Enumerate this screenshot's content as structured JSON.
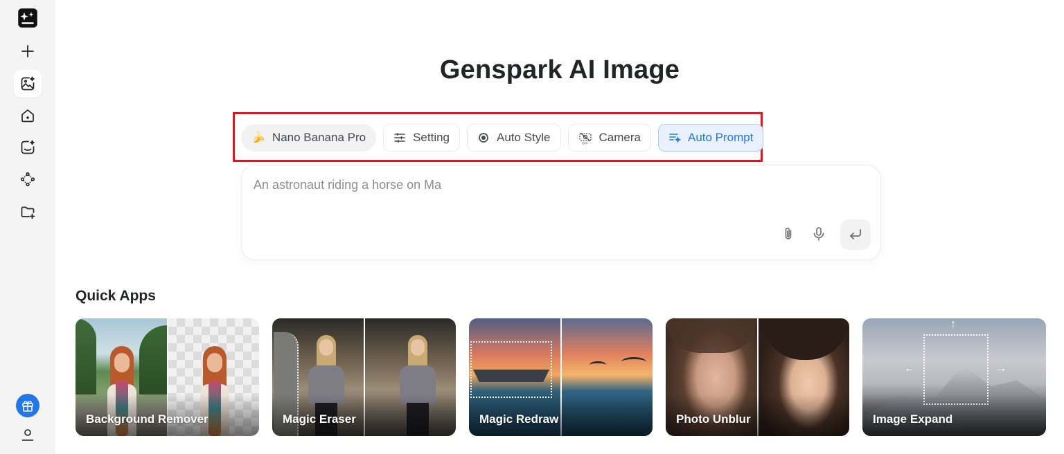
{
  "sidebar": {
    "items": [
      {
        "icon": "genspark-logo-icon"
      },
      {
        "icon": "plus-icon"
      },
      {
        "icon": "ai-image-icon",
        "active": true
      },
      {
        "icon": "home-icon"
      },
      {
        "icon": "image-sparkle-icon"
      },
      {
        "icon": "nodes-icon"
      },
      {
        "icon": "folder-add-icon"
      },
      {
        "icon": "gift-icon"
      },
      {
        "icon": "user-icon"
      }
    ]
  },
  "title": "Genspark AI Image",
  "toolbar": {
    "model_label": "Nano Banana Pro",
    "setting_label": "Setting",
    "style_label": "Auto Style",
    "camera_label": "Camera",
    "prompt_label": "Auto Prompt"
  },
  "prompt": {
    "placeholder": "An astronaut riding a horse on Ma"
  },
  "quick_apps": {
    "title": "Quick Apps",
    "items": [
      {
        "label": "Background Remover"
      },
      {
        "label": "Magic Eraser"
      },
      {
        "label": "Magic Redraw"
      },
      {
        "label": "Photo Unblur"
      },
      {
        "label": "Image Expand"
      }
    ]
  },
  "colors": {
    "accent": "#2376e5",
    "highlight": "#e3151a",
    "sidebar_bg": "#f4f4f5",
    "gift_button": "#2376e5"
  }
}
